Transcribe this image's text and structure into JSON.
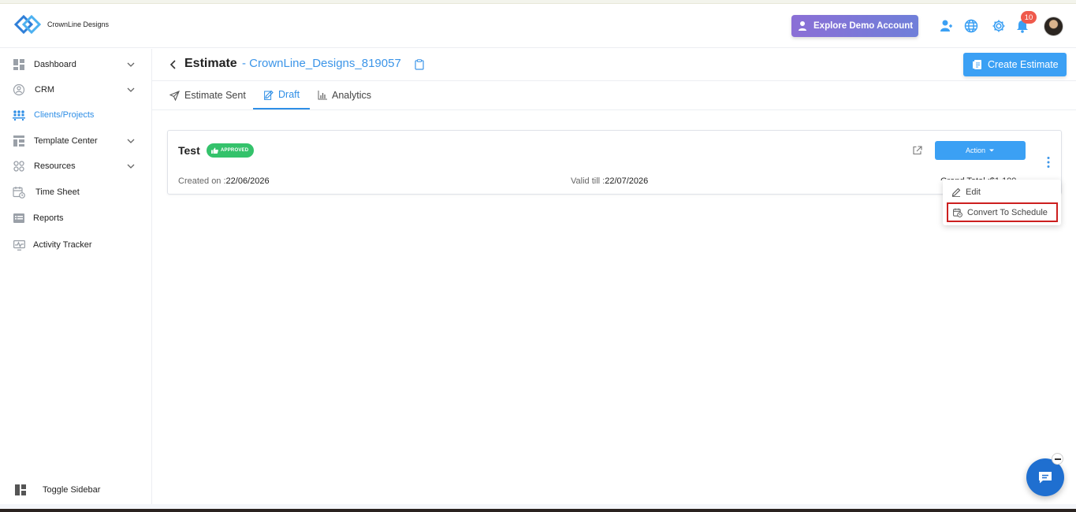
{
  "app": {
    "brand": "CrownLine Designs"
  },
  "header": {
    "demo_button": "Explore Demo Account",
    "notifications_count": "10"
  },
  "sidebar": {
    "items": [
      {
        "label": "Dashboard",
        "icon": "dashboard-icon",
        "has_children": true
      },
      {
        "label": "CRM",
        "icon": "crm-icon",
        "has_children": true
      },
      {
        "label": "Clients/Projects",
        "icon": "clients-icon",
        "has_children": false,
        "active": true
      },
      {
        "label": "Template Center",
        "icon": "template-icon",
        "has_children": true
      },
      {
        "label": "Resources",
        "icon": "resources-icon",
        "has_children": true
      },
      {
        "label": "Time Sheet",
        "icon": "timesheet-icon",
        "has_children": false
      },
      {
        "label": "Reports",
        "icon": "reports-icon",
        "has_children": false
      },
      {
        "label": "Activity Tracker",
        "icon": "activity-icon",
        "has_children": false
      }
    ],
    "toggle_label": "Toggle Sidebar"
  },
  "page": {
    "title": "Estimate",
    "subtitle": "- CrownLine_Designs_819057",
    "create_button": "Create Estimate"
  },
  "tabs": [
    {
      "label": "Estimate Sent",
      "active": false
    },
    {
      "label": "Draft",
      "active": true
    },
    {
      "label": "Analytics",
      "active": false
    }
  ],
  "estimate_card": {
    "name": "Test",
    "status": "APPROVED",
    "action_label": "Action",
    "created_label": "Created on :",
    "created_value": "22/06/2026",
    "valid_label": "Valid till :",
    "valid_value": "22/07/2026",
    "grand_total": "Grand Total :$1,100"
  },
  "dropdown": {
    "items": [
      {
        "label": "Edit",
        "icon": "edit-icon"
      },
      {
        "label": "Convert To Schedule",
        "icon": "calendar-icon",
        "highlighted": true
      }
    ]
  },
  "colors": {
    "accent": "#3ba0f4",
    "link": "#2e8ee6",
    "approved": "#34c26b",
    "badge": "#ef5a4c",
    "highlight_border": "#cc1f1f",
    "chat": "#1f6fd0"
  }
}
